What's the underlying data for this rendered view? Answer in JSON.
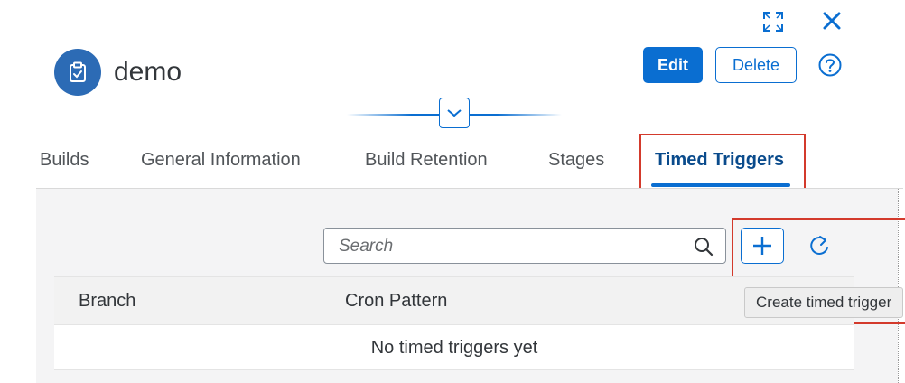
{
  "header": {
    "title": "demo",
    "edit_label": "Edit",
    "delete_label": "Delete"
  },
  "icons": {
    "avatar": "clipboard-check-icon",
    "expand": "expand-icon",
    "close": "close-icon",
    "help": "help-icon",
    "collapse": "chevron-down-icon",
    "search": "search-icon",
    "add": "plus-icon",
    "refresh": "refresh-icon"
  },
  "tabs": [
    {
      "label": "Builds"
    },
    {
      "label": "General Information"
    },
    {
      "label": "Build Retention"
    },
    {
      "label": "Stages"
    },
    {
      "label": "Timed Triggers",
      "selected": true
    }
  ],
  "toolbar": {
    "search_placeholder": "Search",
    "add_tooltip": "Create timed trigger"
  },
  "table": {
    "columns": [
      "Branch",
      "Cron Pattern"
    ],
    "empty_text": "No timed triggers yet"
  },
  "colors": {
    "accent": "#0a6ed1",
    "avatar_bg": "#2c6bb5",
    "highlight": "#d33a2c"
  }
}
